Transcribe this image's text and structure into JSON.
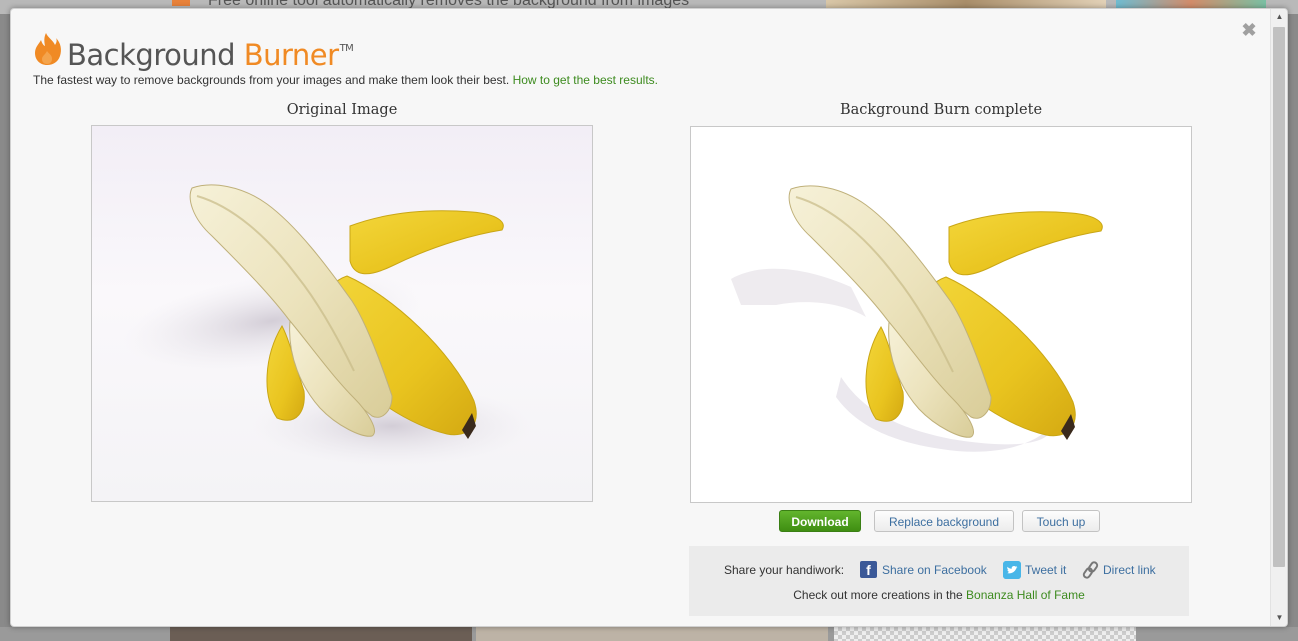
{
  "backdrop": {
    "snippet": "Free online tool automatically removes the background from images"
  },
  "brand": {
    "name_part1": "Background",
    "name_part2": "Burner",
    "trademark": "TM",
    "accent_color": "#f08a24"
  },
  "tagline": {
    "text": "The fastest way to remove backgrounds from your images and make them look their best.",
    "link": "How to get the best results."
  },
  "panels": {
    "original_title": "Original Image",
    "result_title": "Background Burn complete"
  },
  "actions": {
    "download": "Download",
    "replace_background": "Replace background",
    "touch_up": "Touch up"
  },
  "share": {
    "label": "Share your handiwork:",
    "facebook": "Share on Facebook",
    "twitter": "Tweet it",
    "direct": "Direct link",
    "more_prefix": "Check out more creations in the",
    "more_link": "Bonanza Hall of Fame"
  },
  "icons": {
    "close": "close-icon",
    "facebook": "facebook-icon",
    "twitter": "twitter-icon",
    "link": "link-icon",
    "logo": "flame-icon"
  },
  "colors": {
    "download_green": "#4fa11d",
    "link_blue": "#3d6fa0",
    "link_green": "#3d8b1f"
  }
}
